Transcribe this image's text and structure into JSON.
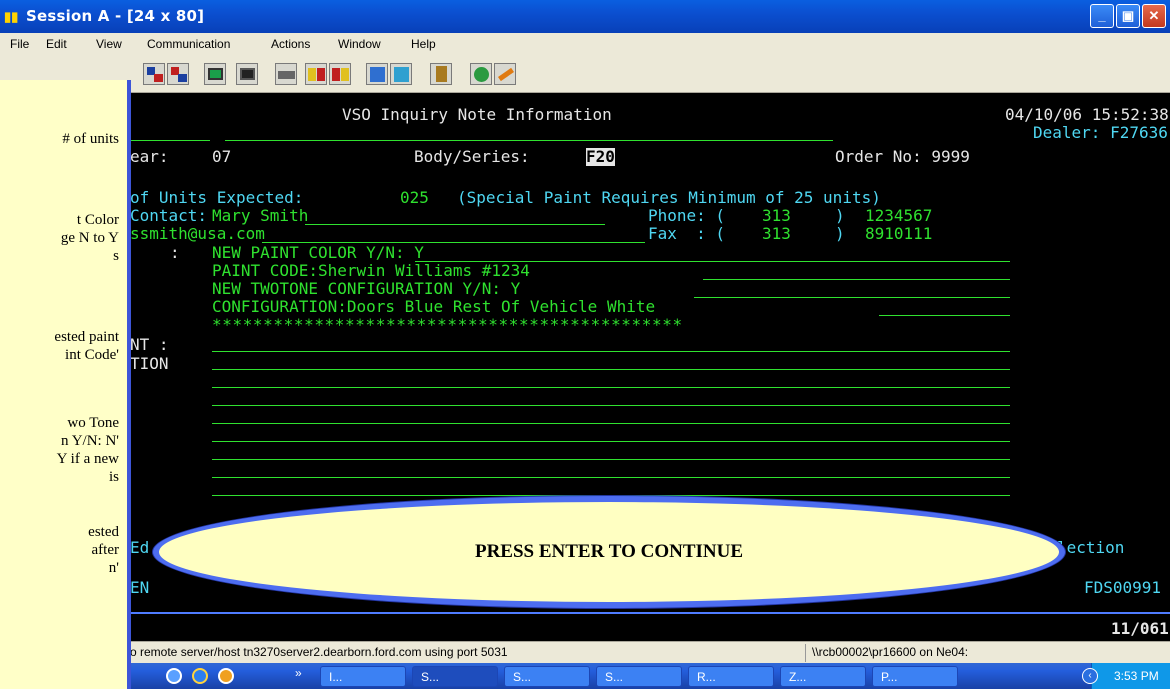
{
  "window": {
    "title": "Session A - [24 x 80]",
    "buttons": {
      "minimize": "_",
      "maximize": "▣",
      "close": "✕"
    }
  },
  "menu": [
    "File",
    "Edit",
    "View",
    "Communication",
    "Actions",
    "Window",
    "Help"
  ],
  "toolbar_icons": [
    "send-file-icon",
    "receive-file-icon",
    "screen-icon",
    "screen-alt-icon",
    "keyboard-icon",
    "macro-play-icon",
    "macro-record-icon",
    "transfer-icon",
    "transfer-alt-icon",
    "clipboard-icon",
    "globe-icon",
    "pencil-icon"
  ],
  "terminal": {
    "screen_title": "VSO Inquiry Note Information",
    "datetime": "04/10/06 15:52:38",
    "dealer": "Dealer: F27636",
    "year_label": "ear:",
    "year_value": "07",
    "body_series_label": "Body/Series:",
    "body_series_value": "F20",
    "order_no": "Order No: 9999",
    "units_label": "of Units Expected:",
    "units_value": "025",
    "units_note": "(Special Paint Requires Minimum of 25 units)",
    "contact_label": "Contact:",
    "contact_value": "Mary Smith",
    "phone_label": "Phone: (",
    "phone_area": "313",
    "phone_close": ")",
    "phone_number": "1234567",
    "email_value": "ssmith@usa.com",
    "fax_label": "Fax  : (",
    "fax_area": "313",
    "fax_close": ")",
    "fax_number": "8910111",
    "note_colon": ":",
    "note_lines": [
      "NEW PAINT COLOR Y/N: Y",
      "PAINT CODE:Sherwin Williams #1234",
      "NEW TWOTONE CONFIGURATION Y/N: Y",
      "CONFIGURATION:Doors Blue Rest Of Vehicle White",
      "**********************************************"
    ],
    "left_label_1": "NT :",
    "left_label_2": "TION",
    "edit_fragment": "Ed",
    "selection_fragment": "lection",
    "enter_fragment": "EN",
    "screen_id": "FDS00991",
    "page_indicator": "11/061"
  },
  "callout": "PRESS ENTER TO CONTINUE",
  "help_panel": {
    "lines": [
      "# of units",
      "t Color",
      "ge N to Y",
      "s",
      "ested paint",
      "int Code'",
      "wo Tone",
      "n Y/N: N'",
      "Y if a new",
      "is",
      "ested",
      "after",
      "n'"
    ]
  },
  "status": {
    "message": "o remote server/host tn3270server2.dearborn.ford.com using port 5031",
    "path": "\\\\rcb00002\\pr16600 on Ne04:"
  },
  "taskbar": {
    "chevron": "»",
    "tasks": [
      "I...",
      "S...",
      "S...",
      "S...",
      "R...",
      "Z...",
      "P..."
    ],
    "time": "3:53 PM"
  },
  "colors": {
    "terminal_bg": "#000000",
    "field_green": "#2fe12f",
    "label_cyan": "#4fd7f2",
    "text_white": "#e6e6e6",
    "callout_fill": "#ffffc2",
    "callout_border": "#4d6df0",
    "help_bg": "#ffffc8"
  }
}
